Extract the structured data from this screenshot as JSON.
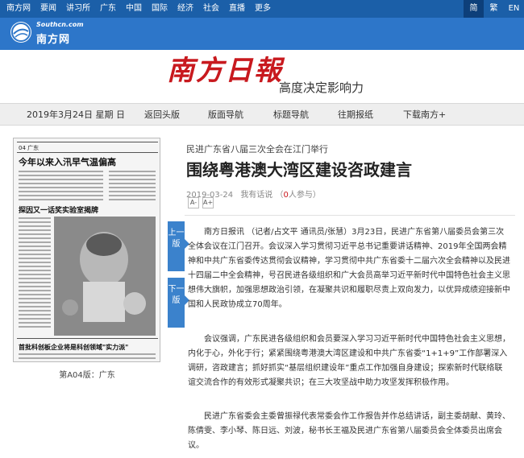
{
  "topnav": {
    "items": [
      "南方网",
      "要闻",
      "讲习所",
      "广东",
      "中国",
      "国际",
      "经济",
      "社会",
      "直播",
      "更多"
    ],
    "langs": [
      "简",
      "繁",
      "EN"
    ]
  },
  "logo": {
    "url": "Southcn.com",
    "name": "南方网"
  },
  "masthead": {
    "title": "南方日報",
    "slogan": "高度决定影响力"
  },
  "subnav": {
    "date": "2019年3月24日 星期 日",
    "back_front": "返回头版",
    "page_nav": "版面导航",
    "title_nav": "标题导航",
    "past_issues": "往期报纸",
    "download": "下载南方+"
  },
  "thumbnail": {
    "caption": "第A04版：广东",
    "page_label": "04 广东",
    "headline1": "今年以来入汛早气温偏高",
    "headline2": "探因又一话奖实验室揭牌",
    "headline3": "首批科创板企业将是科创领域\"实力派\""
  },
  "article": {
    "subtitle": "民进广东省八届三次全会在江门举行",
    "title": "围绕粤港澳大湾区建设咨政建言",
    "date": "2019-03-24",
    "comment_label": "我有话说",
    "participants_count": "0",
    "participants_suffix": "人参与",
    "font_small": "A-",
    "font_large": "A+",
    "prev_page": "上一版",
    "next_page": "下一版",
    "paragraphs": [
      "南方日报讯 （记者/占文平 通讯员/张慧）3月23日，民进广东省第八届委员会第三次全体会议在江门召开。会议深入学习贯彻习近平总书记重要讲话精神、2019年全国两会精神和中共广东省委传达贯彻会议精神，学习贯彻中共广东省委十二届六次全会精神以及民进十四届二中全会精神，号召民进各级组织和广大会员高举习近平新时代中国特色社会主义思想伟大旗帜，加强思想政治引领，在凝聚共识和履职尽责上双向发力，以优异成绩迎接新中国和人民政协成立70周年。",
      "会议强调，广东民进各级组织和会员要深入学习习近平新时代中国特色社会主义思想，内化于心，外化于行；紧紧围绕粤港澳大湾区建设和中共广东省委“1+1+9”工作部署深入调研，咨政建言；抓好抓实“基层组织建设年”重点工作加强自身建设；探索新时代联络联谊交流合作的有效形式凝聚共识；在三大攻坚战中助力攻坚发挥积极作用。",
      "民进广东省委会主委曾振禄代表常委会作工作报告并作总结讲话，副主委胡献、黄玲、陈倩雯、李小琴、陈日远、刘波，秘书长王福及民进广东省第八届委员会全体委员出席会议。"
    ]
  }
}
